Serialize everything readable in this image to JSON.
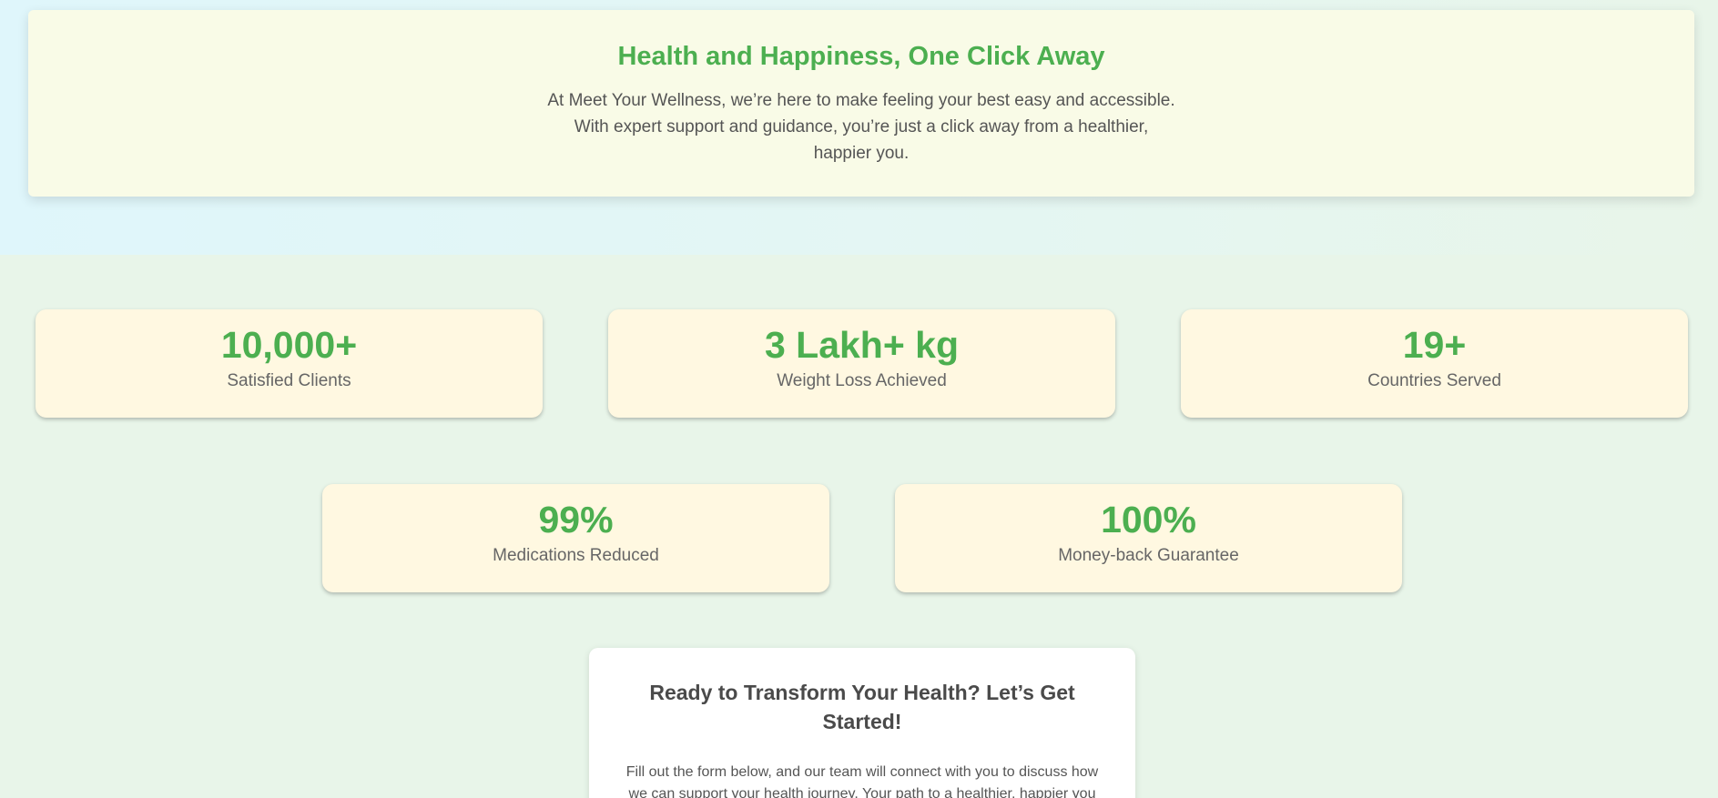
{
  "hero": {
    "title": "Health and Happiness, One Click Away",
    "text": "At Meet Your Wellness, we’re here to make feeling your best easy and accessible. With expert support and guidance, you’re just a click away from a healthier, happier you."
  },
  "stats": [
    {
      "value": "10,000+",
      "label": "Satisfied Clients"
    },
    {
      "value": "3 Lakh+ kg",
      "label": "Weight Loss Achieved"
    },
    {
      "value": "19+",
      "label": "Countries Served"
    },
    {
      "value": "99%",
      "label": "Medications Reduced"
    },
    {
      "value": "100%",
      "label": "Money-back Guarantee"
    }
  ],
  "cta": {
    "title": "Ready to Transform Your Health? Let’s Get Started!",
    "text": "Fill out the form below, and our team will connect with you to discuss how we can support your health journey. Your path to a healthier, happier you"
  },
  "colors": {
    "accent_green": "#4caf50",
    "page_background": "#e8f5e9",
    "hero_card": "#f9fbe7",
    "stat_card": "#fff8e1"
  }
}
